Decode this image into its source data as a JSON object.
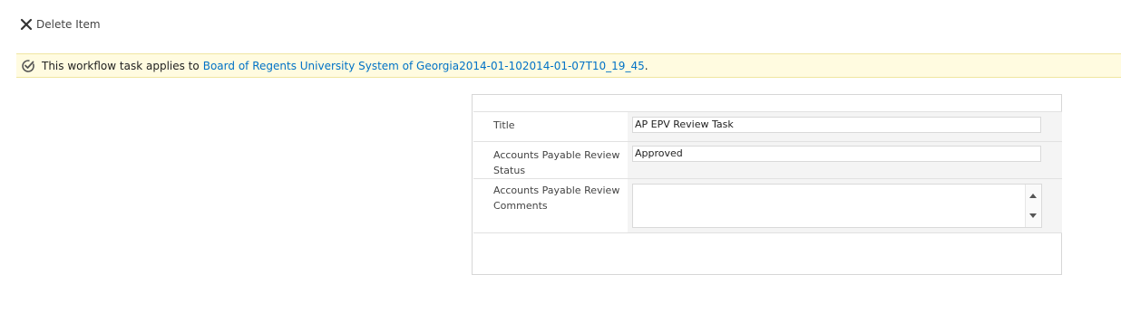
{
  "toolbar": {
    "delete_label": "Delete Item"
  },
  "banner": {
    "prefix": "This workflow task applies to",
    "link_text": "Board of Regents University System of Georgia2014-01-102014-01-07T10_19_45",
    "suffix": "."
  },
  "form": {
    "fields": [
      {
        "label": "Title",
        "value": "AP EPV Review Task"
      },
      {
        "label": "Accounts Payable Review Status",
        "value": "Approved"
      },
      {
        "label": "Accounts Payable Review Comments",
        "value": ""
      }
    ]
  },
  "colors": {
    "banner_bg": "#fffbe0",
    "link": "#0072c6",
    "field_bg": "#f4f4f4"
  },
  "icons": {
    "delete": "close-icon",
    "banner": "workflow-check-icon",
    "scroll_up": "chevron-up-icon",
    "scroll_down": "chevron-down-icon"
  }
}
